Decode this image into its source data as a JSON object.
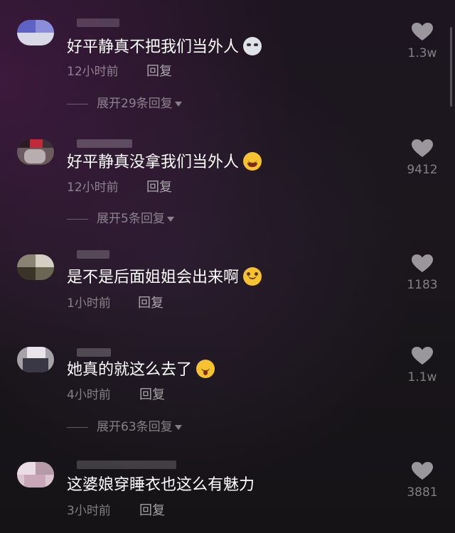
{
  "reply_label": "回复",
  "comments": [
    {
      "text": "好平静真不把我们当外人",
      "emoji": "cat-emoji",
      "time": "12小时前",
      "likes": "1.3w",
      "expand": "展开29条回复"
    },
    {
      "text": "好平静真没拿我们当外人",
      "emoji": "rolling-laugh-emoji",
      "time": "12小时前",
      "likes": "9412",
      "expand": "展开5条回复"
    },
    {
      "text": "是不是后面姐姐会出来啊",
      "emoji": "pleading-face-emoji",
      "time": "1小时前",
      "likes": "1183",
      "expand": null
    },
    {
      "text": "她真的就这么去了",
      "emoji": "surprised-face-emoji",
      "time": "4小时前",
      "likes": "1.1w",
      "expand": "展开63条回复"
    },
    {
      "text": "这婆娘穿睡衣也这么有魅力",
      "emoji": null,
      "time": "3小时前",
      "likes": "3881",
      "expand": null
    }
  ],
  "colors": {
    "text": "#ffffff",
    "meta": "#8a8590",
    "heart": "#9a979c"
  }
}
